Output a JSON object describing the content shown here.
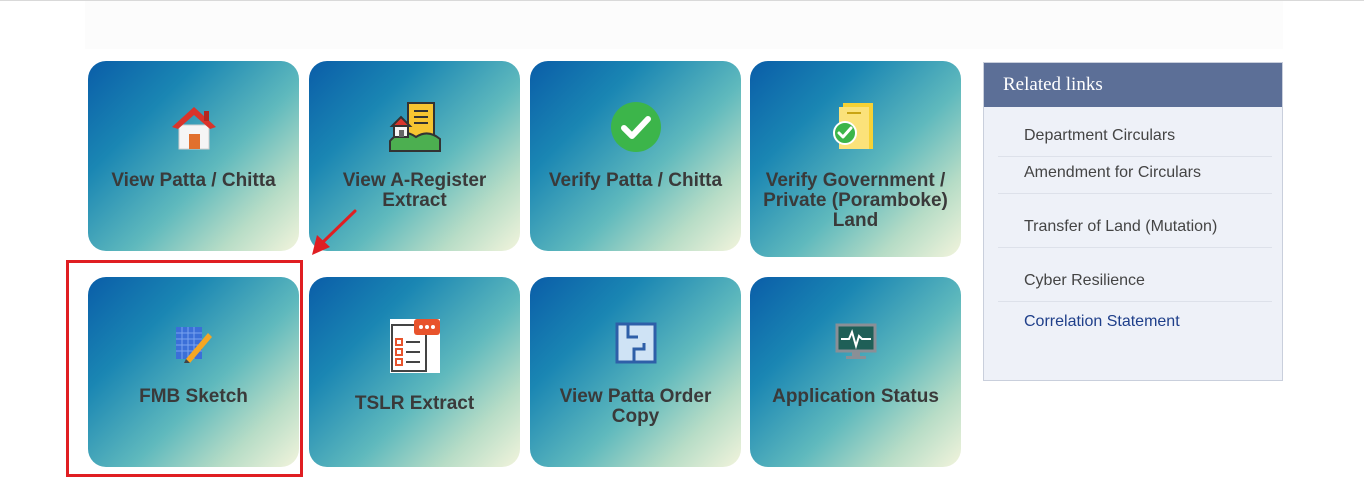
{
  "tiles": [
    {
      "label": "View Patta / Chitta",
      "icon": "house-icon"
    },
    {
      "label": "View A-Register Extract",
      "icon": "land-document-icon"
    },
    {
      "label": "Verify Patta / Chitta",
      "icon": "green-checkmark-icon"
    },
    {
      "label": "Verify Government / Private (Poramboke) Land",
      "icon": "verified-document-icon"
    },
    {
      "label": "FMB Sketch",
      "icon": "ruler-grid-icon"
    },
    {
      "label": "TSLR Extract",
      "icon": "checklist-icon"
    },
    {
      "label": "View Patta Order Copy",
      "icon": "floor-plan-icon"
    },
    {
      "label": "Application Status",
      "icon": "monitor-pulse-icon"
    }
  ],
  "related_links": {
    "title": "Related links",
    "items": [
      "Department Circulars",
      "Amendment for Circulars",
      "Transfer of Land (Mutation)",
      "Cyber Resilience",
      "Correlation Statement"
    ]
  },
  "colors": {
    "highlight": "#e01e22",
    "related_header": "#5c6f97",
    "tile_gradient_start": "#0a5da8",
    "tile_gradient_end": "#f2f4dc"
  }
}
